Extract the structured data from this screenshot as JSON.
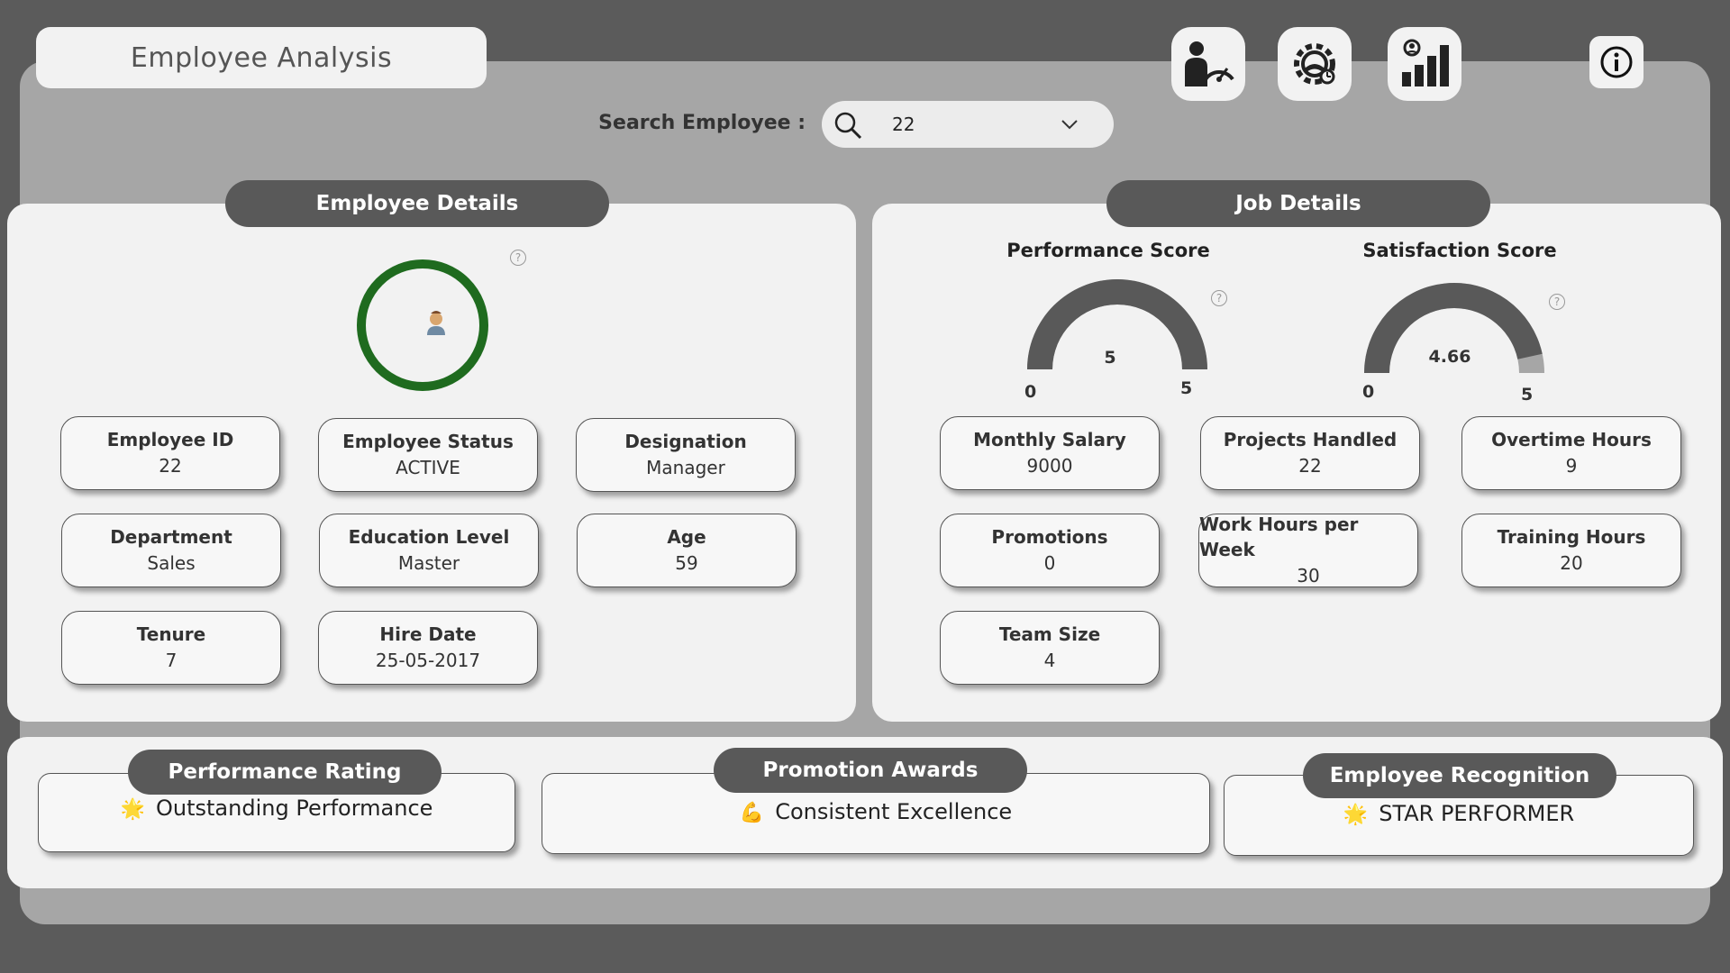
{
  "header": {
    "title": "Employee Analysis",
    "nav_icons": [
      "employee-performance-icon",
      "settings-gear-icon",
      "employee-chart-icon"
    ],
    "info_icon": "info-icon"
  },
  "search": {
    "label": "Search Employee :",
    "value": "22"
  },
  "employee_details": {
    "header": "Employee Details",
    "avatar_ring_color": "#1f6b1f",
    "fields": [
      {
        "label": "Employee ID",
        "value": "22"
      },
      {
        "label": "Employee Status",
        "value": "ACTIVE"
      },
      {
        "label": "Designation",
        "value": "Manager"
      },
      {
        "label": "Department",
        "value": "Sales"
      },
      {
        "label": "Education Level",
        "value": "Master"
      },
      {
        "label": "Age",
        "value": "59"
      },
      {
        "label": "Tenure",
        "value": "7"
      },
      {
        "label": "Hire Date",
        "value": "25-05-2017"
      }
    ]
  },
  "job_details": {
    "header": "Job Details",
    "performance_gauge": {
      "title": "Performance Score",
      "value": 5,
      "value_label": "5",
      "min_label": "0",
      "max_label": "5",
      "min": 0,
      "max": 5
    },
    "satisfaction_gauge": {
      "title": "Satisfaction Score",
      "value": 4.66,
      "value_label": "4.66",
      "min_label": "0",
      "max_label": "5",
      "min": 0,
      "max": 5
    },
    "fields": [
      {
        "label": "Monthly Salary",
        "value": "9000"
      },
      {
        "label": "Projects Handled",
        "value": "22"
      },
      {
        "label": "Overtime Hours",
        "value": "9"
      },
      {
        "label": "Promotions",
        "value": "0"
      },
      {
        "label": "Work Hours per Week",
        "value": "30"
      },
      {
        "label": "Training Hours",
        "value": "20"
      },
      {
        "label": "Team Size",
        "value": "4"
      }
    ]
  },
  "awards": {
    "performance_rating": {
      "header": "Performance Rating",
      "emoji": "🌟",
      "text": "Outstanding Performance"
    },
    "promotion_awards": {
      "header": "Promotion Awards",
      "emoji": "💪",
      "text": "Consistent Excellence"
    },
    "employee_recognition": {
      "header": "Employee Recognition",
      "emoji": "🌟",
      "text": "STAR PERFORMER"
    }
  },
  "colors": {
    "dark_gray": "#595959",
    "panel_gray": "#a6a6a6",
    "card_bg": "#f2f2f2",
    "gauge_fill": "#595959",
    "gauge_remainder": "#a6a6a6"
  }
}
